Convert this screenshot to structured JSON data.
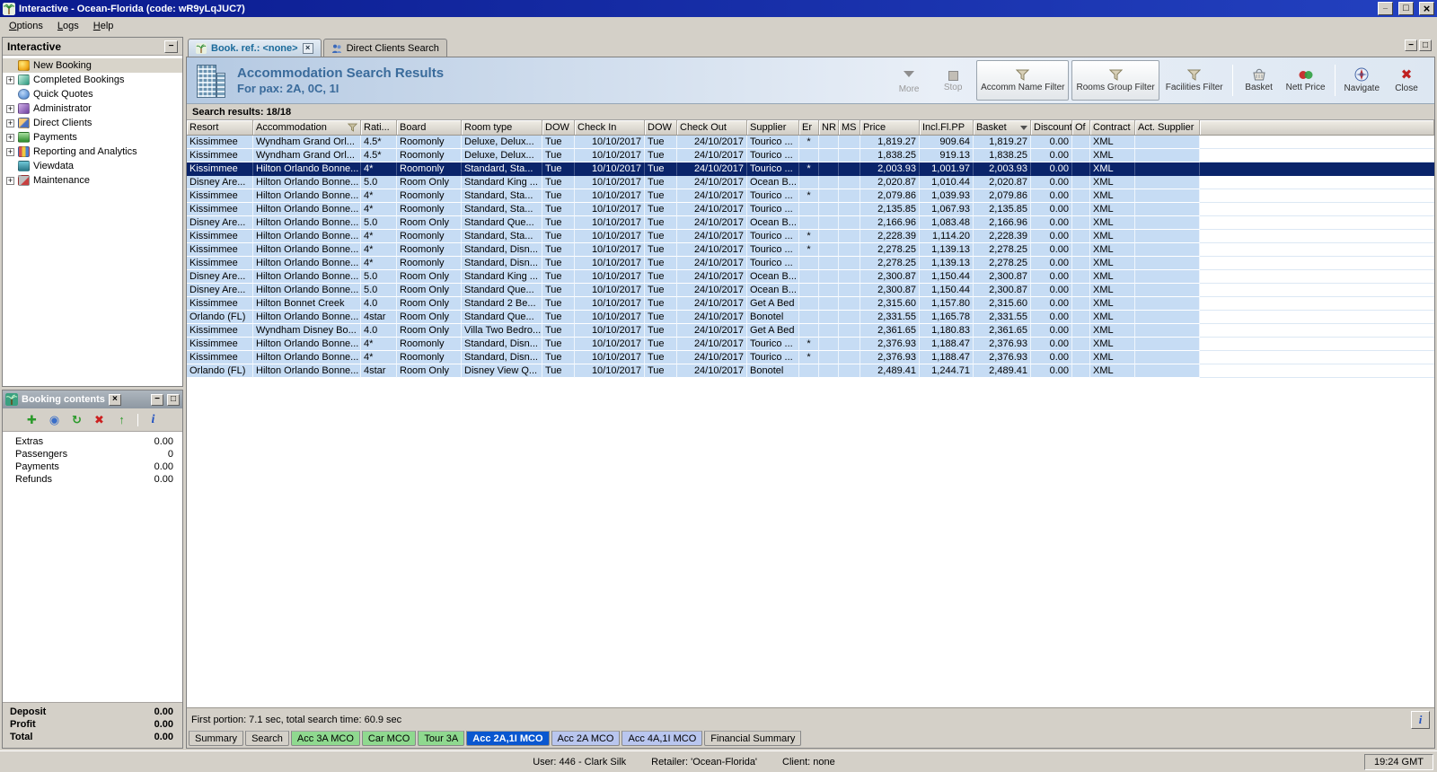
{
  "window": {
    "title": "Interactive - Ocean-Florida (code: wR9yLqJUC7)",
    "menu": [
      "Options",
      "Logs",
      "Help"
    ]
  },
  "colors": {
    "titlebar": "#0a1a8e",
    "row_bg": "#c6dcf4",
    "selected_row_bg": "#0a246a",
    "header_title": "#3a6b9b",
    "active_bottom_tab": "#0a57d0",
    "green_tab": "#8fd98f",
    "light_blue_tab": "#b9c6ef"
  },
  "sidebar": {
    "title": "Interactive",
    "items": [
      {
        "label": "New Booking",
        "icon": "new-booking-icon",
        "flags": [
          "selected"
        ]
      },
      {
        "label": "Completed Bookings",
        "icon": "completed-bookings-icon",
        "flags": [
          "expandable"
        ]
      },
      {
        "label": "Quick Quotes",
        "icon": "quick-quotes-icon",
        "flags": []
      },
      {
        "label": "Administrator",
        "icon": "administrator-icon",
        "flags": [
          "expandable"
        ]
      },
      {
        "label": "Direct Clients",
        "icon": "direct-clients-icon",
        "flags": [
          "expandable"
        ]
      },
      {
        "label": "Payments",
        "icon": "payments-icon",
        "flags": [
          "expandable"
        ]
      },
      {
        "label": "Reporting and Analytics",
        "icon": "reporting-icon",
        "flags": [
          "expandable"
        ]
      },
      {
        "label": "Viewdata",
        "icon": "viewdata-icon",
        "flags": []
      },
      {
        "label": "Maintenance",
        "icon": "maintenance-icon",
        "flags": [
          "expandable"
        ]
      }
    ]
  },
  "booking_contents": {
    "title": "Booking contents",
    "rows": [
      {
        "label": "Extras",
        "value": "0.00"
      },
      {
        "label": "Passengers",
        "value": "0"
      },
      {
        "label": "Payments",
        "value": "0.00"
      },
      {
        "label": "Refunds",
        "value": "0.00"
      }
    ],
    "totals": [
      {
        "label": "Deposit",
        "value": "0.00"
      },
      {
        "label": "Profit",
        "value": "0.00"
      },
      {
        "label": "Total",
        "value": "0.00"
      }
    ]
  },
  "main": {
    "tabs": [
      {
        "label": "Book. ref.: <none>"
      },
      {
        "label": "Direct Clients Search"
      }
    ],
    "header": {
      "title": "Accommodation Search Results",
      "subtitle": "For pax: 2A, 0C, 1I"
    },
    "toolbar": {
      "more": "More",
      "stop": "Stop",
      "accomm_filter": "Accomm Name Filter",
      "rooms_filter": "Rooms Group Filter",
      "facilities_filter": "Facilities Filter",
      "basket": "Basket",
      "nett_price": "Nett Price",
      "navigate": "Navigate",
      "close": "Close"
    },
    "results_label": "Search results: 18/18",
    "timing": "First portion: 7.1 sec, total search time: 60.9 sec",
    "bottom_tabs": [
      {
        "label": "Summary",
        "flags": []
      },
      {
        "label": "Search",
        "flags": []
      },
      {
        "label": "Acc 3A MCO",
        "flags": [
          "green"
        ]
      },
      {
        "label": "Car MCO",
        "flags": [
          "green"
        ]
      },
      {
        "label": "Tour 3A",
        "flags": [
          "green"
        ]
      },
      {
        "label": "Acc 2A,1I MCO",
        "flags": [
          "active"
        ]
      },
      {
        "label": "Acc 2A MCO",
        "flags": [
          "lblue"
        ]
      },
      {
        "label": "Acc 4A,1I MCO",
        "flags": [
          "lblue"
        ]
      },
      {
        "label": "Financial Summary",
        "flags": []
      }
    ]
  },
  "table": {
    "columns": [
      "Resort",
      "Accommodation",
      "Rati...",
      "Board",
      "Room type",
      "DOW",
      "Check In",
      "DOW",
      "Check Out",
      "Supplier",
      "Er",
      "NR",
      "MS",
      "Price",
      "Incl.Fl.PP",
      "Basket",
      "Discount",
      "Of",
      "Contract",
      "Act. Supplier"
    ],
    "rows": [
      {
        "c": [
          "Kissimmee",
          "Wyndham Grand Orl...",
          "4.5*",
          "Roomonly",
          "Deluxe, Delux...",
          "Tue",
          "10/10/2017",
          "Tue",
          "24/10/2017",
          "Tourico ...",
          "*",
          "",
          "",
          "1,819.27",
          "909.64",
          "1,819.27",
          "0.00",
          "",
          "XML",
          ""
        ],
        "flags": []
      },
      {
        "c": [
          "Kissimmee",
          "Wyndham Grand Orl...",
          "4.5*",
          "Roomonly",
          "Deluxe, Delux...",
          "Tue",
          "10/10/2017",
          "Tue",
          "24/10/2017",
          "Tourico ...",
          "",
          "",
          "",
          "1,838.25",
          "919.13",
          "1,838.25",
          "0.00",
          "",
          "XML",
          ""
        ],
        "flags": []
      },
      {
        "c": [
          "Kissimmee",
          "Hilton Orlando Bonne...",
          "4*",
          "Roomonly",
          "Standard, Sta...",
          "Tue",
          "10/10/2017",
          "Tue",
          "24/10/2017",
          "Tourico ...",
          "*",
          "",
          "",
          "2,003.93",
          "1,001.97",
          "2,003.93",
          "0.00",
          "",
          "XML",
          ""
        ],
        "flags": [
          "selected"
        ]
      },
      {
        "c": [
          "Disney Are...",
          "Hilton Orlando Bonne...",
          "5.0",
          "Room Only",
          "Standard King ...",
          "Tue",
          "10/10/2017",
          "Tue",
          "24/10/2017",
          "Ocean B...",
          "",
          "",
          "",
          "2,020.87",
          "1,010.44",
          "2,020.87",
          "0.00",
          "",
          "XML",
          ""
        ],
        "flags": []
      },
      {
        "c": [
          "Kissimmee",
          "Hilton Orlando Bonne...",
          "4*",
          "Roomonly",
          "Standard, Sta...",
          "Tue",
          "10/10/2017",
          "Tue",
          "24/10/2017",
          "Tourico ...",
          "*",
          "",
          "",
          "2,079.86",
          "1,039.93",
          "2,079.86",
          "0.00",
          "",
          "XML",
          ""
        ],
        "flags": []
      },
      {
        "c": [
          "Kissimmee",
          "Hilton Orlando Bonne...",
          "4*",
          "Roomonly",
          "Standard, Sta...",
          "Tue",
          "10/10/2017",
          "Tue",
          "24/10/2017",
          "Tourico ...",
          "",
          "",
          "",
          "2,135.85",
          "1,067.93",
          "2,135.85",
          "0.00",
          "",
          "XML",
          ""
        ],
        "flags": []
      },
      {
        "c": [
          "Disney Are...",
          "Hilton Orlando Bonne...",
          "5.0",
          "Room Only",
          "Standard Que...",
          "Tue",
          "10/10/2017",
          "Tue",
          "24/10/2017",
          "Ocean B...",
          "",
          "",
          "",
          "2,166.96",
          "1,083.48",
          "2,166.96",
          "0.00",
          "",
          "XML",
          ""
        ],
        "flags": []
      },
      {
        "c": [
          "Kissimmee",
          "Hilton Orlando Bonne...",
          "4*",
          "Roomonly",
          "Standard, Sta...",
          "Tue",
          "10/10/2017",
          "Tue",
          "24/10/2017",
          "Tourico ...",
          "*",
          "",
          "",
          "2,228.39",
          "1,114.20",
          "2,228.39",
          "0.00",
          "",
          "XML",
          ""
        ],
        "flags": []
      },
      {
        "c": [
          "Kissimmee",
          "Hilton Orlando Bonne...",
          "4*",
          "Roomonly",
          "Standard, Disn...",
          "Tue",
          "10/10/2017",
          "Tue",
          "24/10/2017",
          "Tourico ...",
          "*",
          "",
          "",
          "2,278.25",
          "1,139.13",
          "2,278.25",
          "0.00",
          "",
          "XML",
          ""
        ],
        "flags": []
      },
      {
        "c": [
          "Kissimmee",
          "Hilton Orlando Bonne...",
          "4*",
          "Roomonly",
          "Standard, Disn...",
          "Tue",
          "10/10/2017",
          "Tue",
          "24/10/2017",
          "Tourico ...",
          "",
          "",
          "",
          "2,278.25",
          "1,139.13",
          "2,278.25",
          "0.00",
          "",
          "XML",
          ""
        ],
        "flags": []
      },
      {
        "c": [
          "Disney Are...",
          "Hilton Orlando Bonne...",
          "5.0",
          "Room Only",
          "Standard King ...",
          "Tue",
          "10/10/2017",
          "Tue",
          "24/10/2017",
          "Ocean B...",
          "",
          "",
          "",
          "2,300.87",
          "1,150.44",
          "2,300.87",
          "0.00",
          "",
          "XML",
          ""
        ],
        "flags": []
      },
      {
        "c": [
          "Disney Are...",
          "Hilton Orlando Bonne...",
          "5.0",
          "Room Only",
          "Standard Que...",
          "Tue",
          "10/10/2017",
          "Tue",
          "24/10/2017",
          "Ocean B...",
          "",
          "",
          "",
          "2,300.87",
          "1,150.44",
          "2,300.87",
          "0.00",
          "",
          "XML",
          ""
        ],
        "flags": []
      },
      {
        "c": [
          "Kissimmee",
          "Hilton Bonnet Creek",
          "4.0",
          "Room Only",
          "Standard 2 Be...",
          "Tue",
          "10/10/2017",
          "Tue",
          "24/10/2017",
          "Get A Bed",
          "",
          "",
          "",
          "2,315.60",
          "1,157.80",
          "2,315.60",
          "0.00",
          "",
          "XML",
          ""
        ],
        "flags": []
      },
      {
        "c": [
          "Orlando (FL)",
          "Hilton Orlando Bonne...",
          "4star",
          "Room Only",
          "Standard Que...",
          "Tue",
          "10/10/2017",
          "Tue",
          "24/10/2017",
          "Bonotel",
          "",
          "",
          "",
          "2,331.55",
          "1,165.78",
          "2,331.55",
          "0.00",
          "",
          "XML",
          ""
        ],
        "flags": []
      },
      {
        "c": [
          "Kissimmee",
          "Wyndham Disney Bo...",
          "4.0",
          "Room Only",
          "Villa Two Bedro...",
          "Tue",
          "10/10/2017",
          "Tue",
          "24/10/2017",
          "Get A Bed",
          "",
          "",
          "",
          "2,361.65",
          "1,180.83",
          "2,361.65",
          "0.00",
          "",
          "XML",
          ""
        ],
        "flags": []
      },
      {
        "c": [
          "Kissimmee",
          "Hilton Orlando Bonne...",
          "4*",
          "Roomonly",
          "Standard, Disn...",
          "Tue",
          "10/10/2017",
          "Tue",
          "24/10/2017",
          "Tourico ...",
          "*",
          "",
          "",
          "2,376.93",
          "1,188.47",
          "2,376.93",
          "0.00",
          "",
          "XML",
          ""
        ],
        "flags": []
      },
      {
        "c": [
          "Kissimmee",
          "Hilton Orlando Bonne...",
          "4*",
          "Roomonly",
          "Standard, Disn...",
          "Tue",
          "10/10/2017",
          "Tue",
          "24/10/2017",
          "Tourico ...",
          "*",
          "",
          "",
          "2,376.93",
          "1,188.47",
          "2,376.93",
          "0.00",
          "",
          "XML",
          ""
        ],
        "flags": []
      },
      {
        "c": [
          "Orlando (FL)",
          "Hilton Orlando Bonne...",
          "4star",
          "Room Only",
          "Disney View Q...",
          "Tue",
          "10/10/2017",
          "Tue",
          "24/10/2017",
          "Bonotel",
          "",
          "",
          "",
          "2,489.41",
          "1,244.71",
          "2,489.41",
          "0.00",
          "",
          "XML",
          ""
        ],
        "flags": []
      }
    ]
  },
  "statusbar": {
    "user": "User: 446 - Clark Silk",
    "retailer": "Retailer: 'Ocean-Florida'",
    "client": "Client: none",
    "time": "19:24 GMT"
  }
}
